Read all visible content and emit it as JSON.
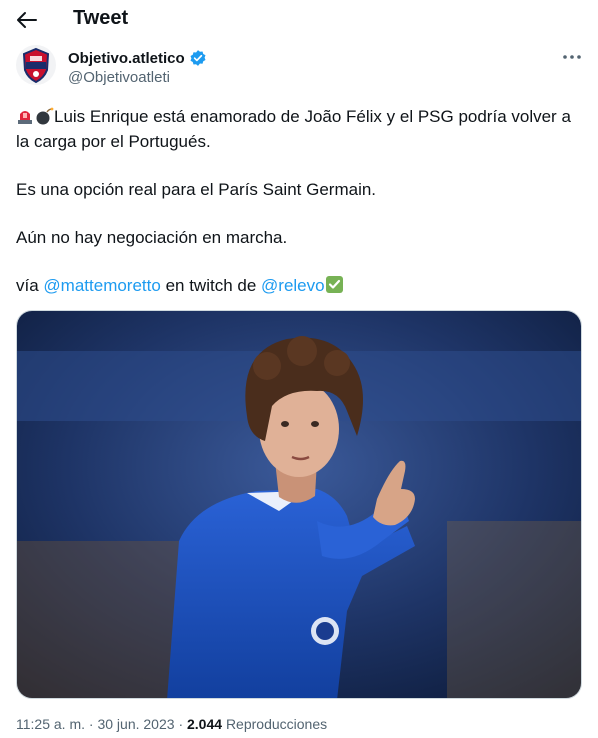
{
  "header": {
    "back_icon": "arrow-left-icon",
    "title": "Tweet"
  },
  "author": {
    "display_name": "Objetivo.atletico",
    "handle": "@Objetivoatleti",
    "avatar_text": "OBJETIVO",
    "verified_color": "#1d9bf0",
    "more_icon": "more-horizontal-icon"
  },
  "tweet": {
    "line1_emojis": [
      "rotating-light-emoji",
      "bomb-emoji"
    ],
    "line1": "Luis Enrique está enamorado de João Félix y el PSG podría volver a la carga por el Portugués.",
    "line2": "Es una opción real para el París Saint Germain.",
    "line3": "Aún no hay negociación en marcha.",
    "line4_prefix": "vía",
    "mention1": "@mattemoretto",
    "line4_middle": "en twitch de",
    "mention2": "@relevo",
    "line4_emoji": "check-mark-button-emoji",
    "link_color": "#1d9bf0"
  },
  "media": {
    "description_icon": "football-player-photo"
  },
  "meta": {
    "time": "11:25 a. m.",
    "separator": "·",
    "date": "30 jun. 2023",
    "views_count": "2.044",
    "views_label": "Reproducciones"
  }
}
